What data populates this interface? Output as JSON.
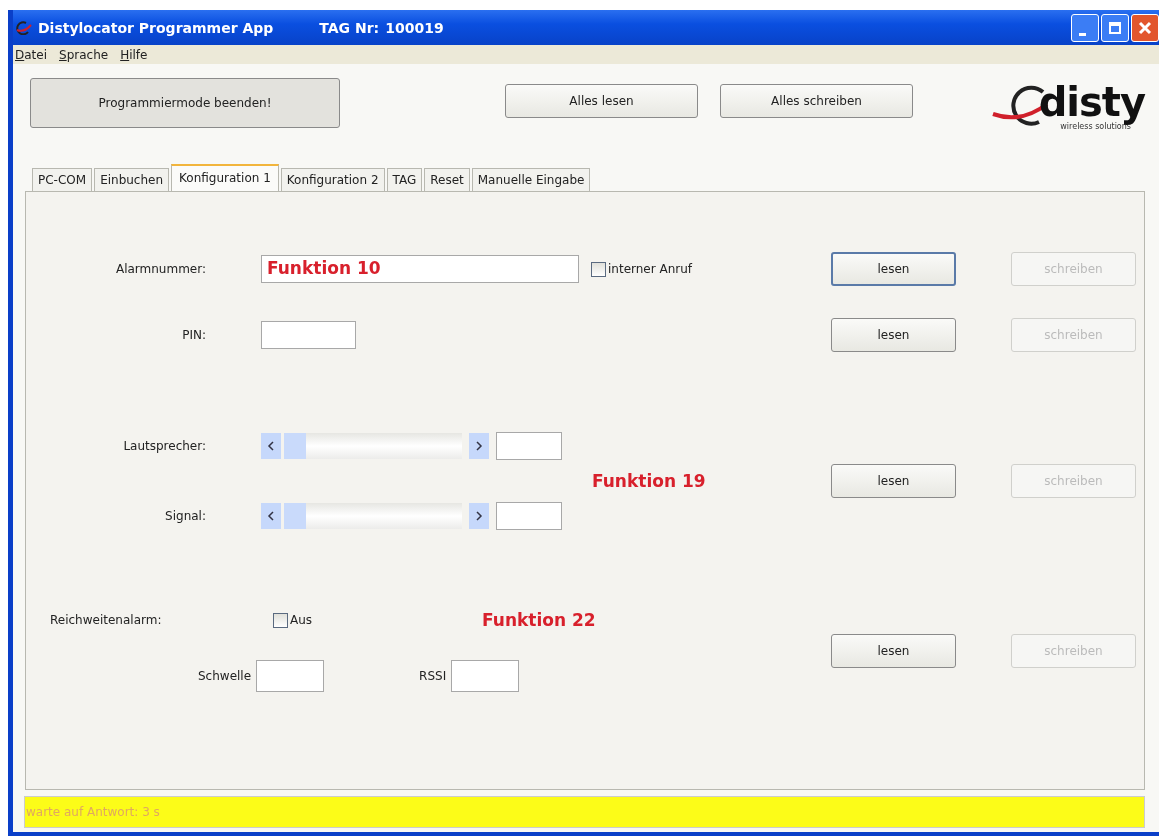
{
  "window": {
    "title": "Distylocator Programmer App",
    "tag_label": "TAG Nr:",
    "tag_number": "100019"
  },
  "menu": [
    {
      "label": "Datei"
    },
    {
      "label": "Sprache"
    },
    {
      "label": "Hilfe"
    }
  ],
  "toolbar": {
    "exit_button": "Programmiermode beenden!",
    "read_all_button": "Alles lesen",
    "write_all_button": "Alles schreiben"
  },
  "logo": {
    "name": "disty",
    "tagline": "wireless solutions"
  },
  "tabs": [
    {
      "label": "PC-COM",
      "selected": false
    },
    {
      "label": "Einbuchen",
      "selected": false
    },
    {
      "label": "Konfiguration 1",
      "selected": true
    },
    {
      "label": "Konfiguration 2",
      "selected": false
    },
    {
      "label": "TAG",
      "selected": false
    },
    {
      "label": "Reset",
      "selected": false
    },
    {
      "label": "Manuelle Eingabe",
      "selected": false
    }
  ],
  "sections": [
    {
      "rows": [
        {
          "kind": "phone",
          "label": "Alarmnummer:",
          "annotation": "Funktion 10",
          "checkbox": {
            "label": "interner Anruf",
            "checked": false
          }
        }
      ],
      "read_button": {
        "label": "lesen",
        "disabled": false
      },
      "write_button": {
        "label": "schreiben",
        "disabled": true
      }
    },
    {
      "rows": [
        {
          "kind": "pin",
          "label": "PIN:"
        }
      ],
      "read_button": {
        "label": "lesen",
        "disabled": false
      },
      "write_button": {
        "label": "schreiben",
        "disabled": true
      }
    },
    {
      "annotation": "Funktion 19",
      "rows": [
        {
          "kind": "slider",
          "label": "Lautsprecher:",
          "level": 0
        },
        {
          "kind": "slider",
          "label": "Signal:",
          "level": 0
        }
      ],
      "read_button": {
        "label": "lesen",
        "disabled": false
      },
      "write_button": {
        "label": "schreiben",
        "disabled": true
      }
    },
    {
      "rows": [
        {
          "kind": "checkbox",
          "label": "Reichweitenalarm:",
          "annotation": "Funktion 22",
          "checkbox": {
            "label": "Aus",
            "checked": false
          }
        },
        {
          "kind": "pair",
          "fields": [
            {
              "label": "Schwelle"
            },
            {
              "label": "RSSI"
            }
          ]
        }
      ],
      "read_button": {
        "label": "lesen",
        "disabled": false
      },
      "write_button": {
        "label": "schreiben",
        "disabled": true
      }
    }
  ],
  "status_bar": {
    "text": "warte auf Antwort: 3 s"
  }
}
